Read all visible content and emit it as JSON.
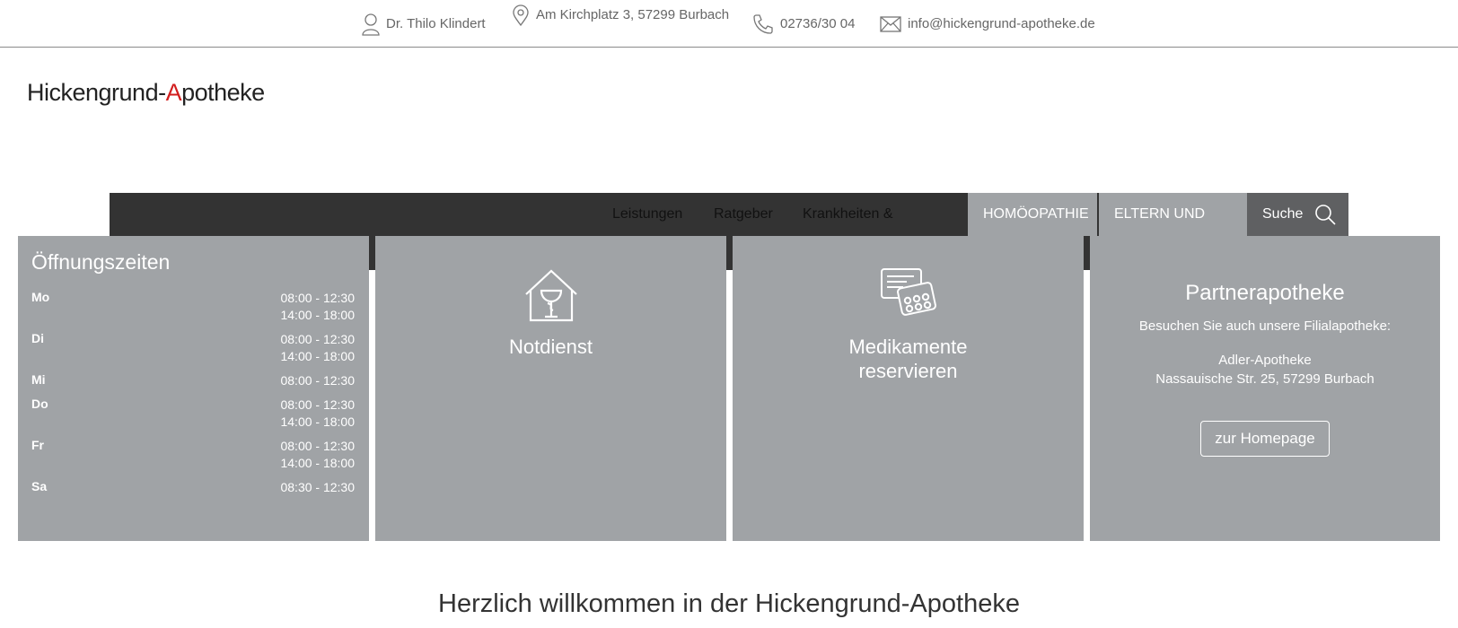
{
  "contact": {
    "name": "Dr. Thilo Klindert",
    "address": "Am Kirchplatz 3, 57299 Burbach",
    "phone": "02736/30 04",
    "email": "info@hickengrund-apotheke.de"
  },
  "logo": {
    "part1": "Hickengrund-",
    "accent": "A",
    "part2": "potheke"
  },
  "nav": {
    "items": [
      "Leistungen",
      "Ratgeber",
      "Krankheiten &"
    ],
    "homoeopathie": "HOMÖOPATHIE",
    "eltern": "ELTERN UND",
    "search": "Suche"
  },
  "hours": {
    "title": "Öffnungszeiten",
    "rows": [
      {
        "day": "Mo",
        "times": [
          "08:00 - 12:30",
          "14:00 - 18:00"
        ]
      },
      {
        "day": "Di",
        "times": [
          "08:00 - 12:30",
          "14:00 - 18:00"
        ]
      },
      {
        "day": "Mi",
        "times": [
          "08:00 - 12:30"
        ]
      },
      {
        "day": "Do",
        "times": [
          "08:00 - 12:30",
          "14:00 - 18:00"
        ]
      },
      {
        "day": "Fr",
        "times": [
          "08:00 - 12:30",
          "14:00 - 18:00"
        ]
      },
      {
        "day": "Sa",
        "times": [
          "08:30 - 12:30"
        ]
      }
    ]
  },
  "tiles": {
    "notdienst": "Notdienst",
    "medikamente_line1": "Medikamente",
    "medikamente_line2": "reservieren"
  },
  "partner": {
    "title": "Partnerapotheke",
    "text": "Besuchen Sie auch unsere Filialapotheke:",
    "name": "Adler-Apotheke",
    "address": "Nassauische Str. 25, 57299 Burbach",
    "button": "zur Homepage"
  },
  "welcome": "Herzlich willkommen in der Hickengrund-Apotheke",
  "colors": {
    "accent": "#d21e1e",
    "tile": "#a0a3a6",
    "nav": "#333333",
    "search": "#5f6062"
  }
}
